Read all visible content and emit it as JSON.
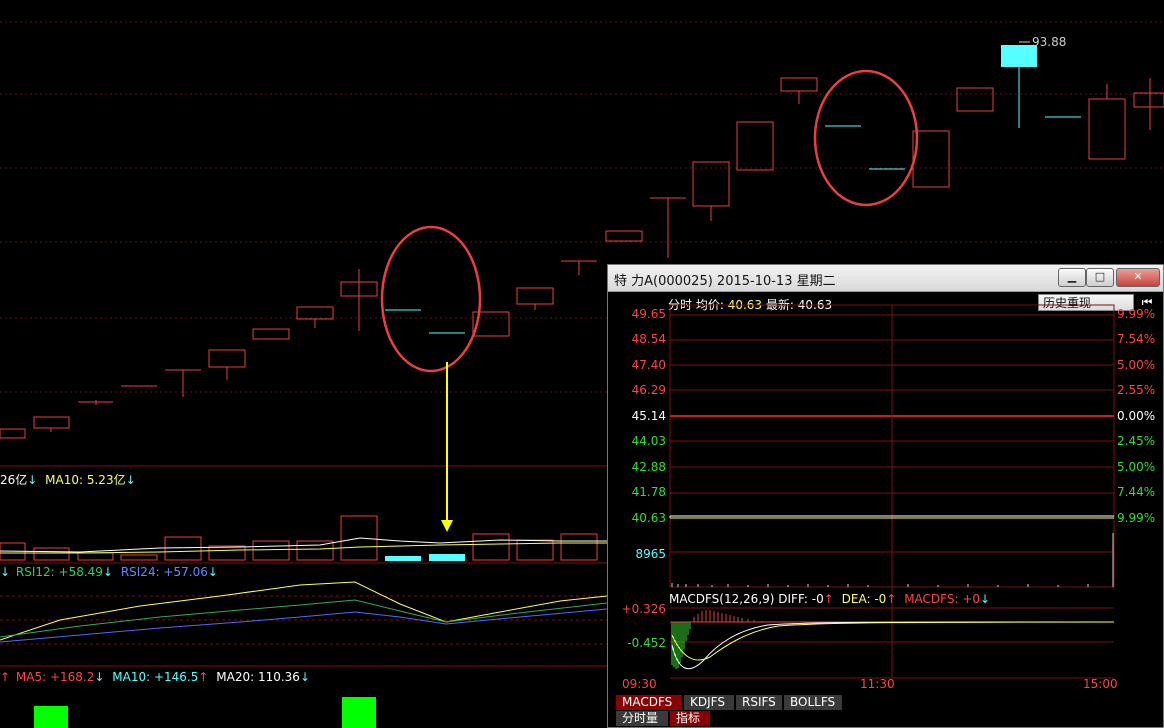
{
  "main_chart": {
    "vol_legend": {
      "prefix": "26亿",
      "ma10_label": "MA10: 5.23亿"
    },
    "rsi_legend": {
      "rsi12": "RSI12: +58.49",
      "rsi24": "RSI24: +57.06"
    },
    "ma_legend": {
      "ma5": "MA5: +168.2",
      "ma10": "MA10: +146.5",
      "ma20": "MA20: 110.36"
    },
    "high_price": "93.88"
  },
  "popup": {
    "title": "特  力A(000025) 2015-10-13 星期二",
    "info": {
      "prefix": "分时 均价:",
      "avg": "40.63",
      "latest_label": "最新:",
      "latest": "40.63"
    },
    "history_button": "历史重现",
    "price_ticks": [
      "49.65",
      "48.54",
      "47.40",
      "46.29",
      "45.14",
      "44.03",
      "42.88",
      "41.78",
      "40.63"
    ],
    "pct_ticks": [
      "9.99%",
      "7.54%",
      "5.00%",
      "2.55%",
      "0.00%",
      "2.45%",
      "5.00%",
      "7.44%",
      "9.99%"
    ],
    "volume_tick": "8965",
    "macd_legend": {
      "name": "MACDFS(12,26,9)",
      "diff": "DIFF: -0",
      "dea": "DEA: -0",
      "macd": "MACDFS: +0"
    },
    "macd_ticks": [
      "+0.326",
      "-0.452"
    ],
    "time_ticks": [
      "09:30",
      "11:30",
      "15:00"
    ],
    "tabs": [
      "MACDFS",
      "KDJFS",
      "RSIFS",
      "BOLLFS"
    ],
    "bottom_tabs": [
      "分时量",
      "指标"
    ]
  },
  "colors": {
    "up": "#e84040",
    "cyan": "#55ffff",
    "yellow": "#ffff55",
    "grid": "#7a1010"
  }
}
